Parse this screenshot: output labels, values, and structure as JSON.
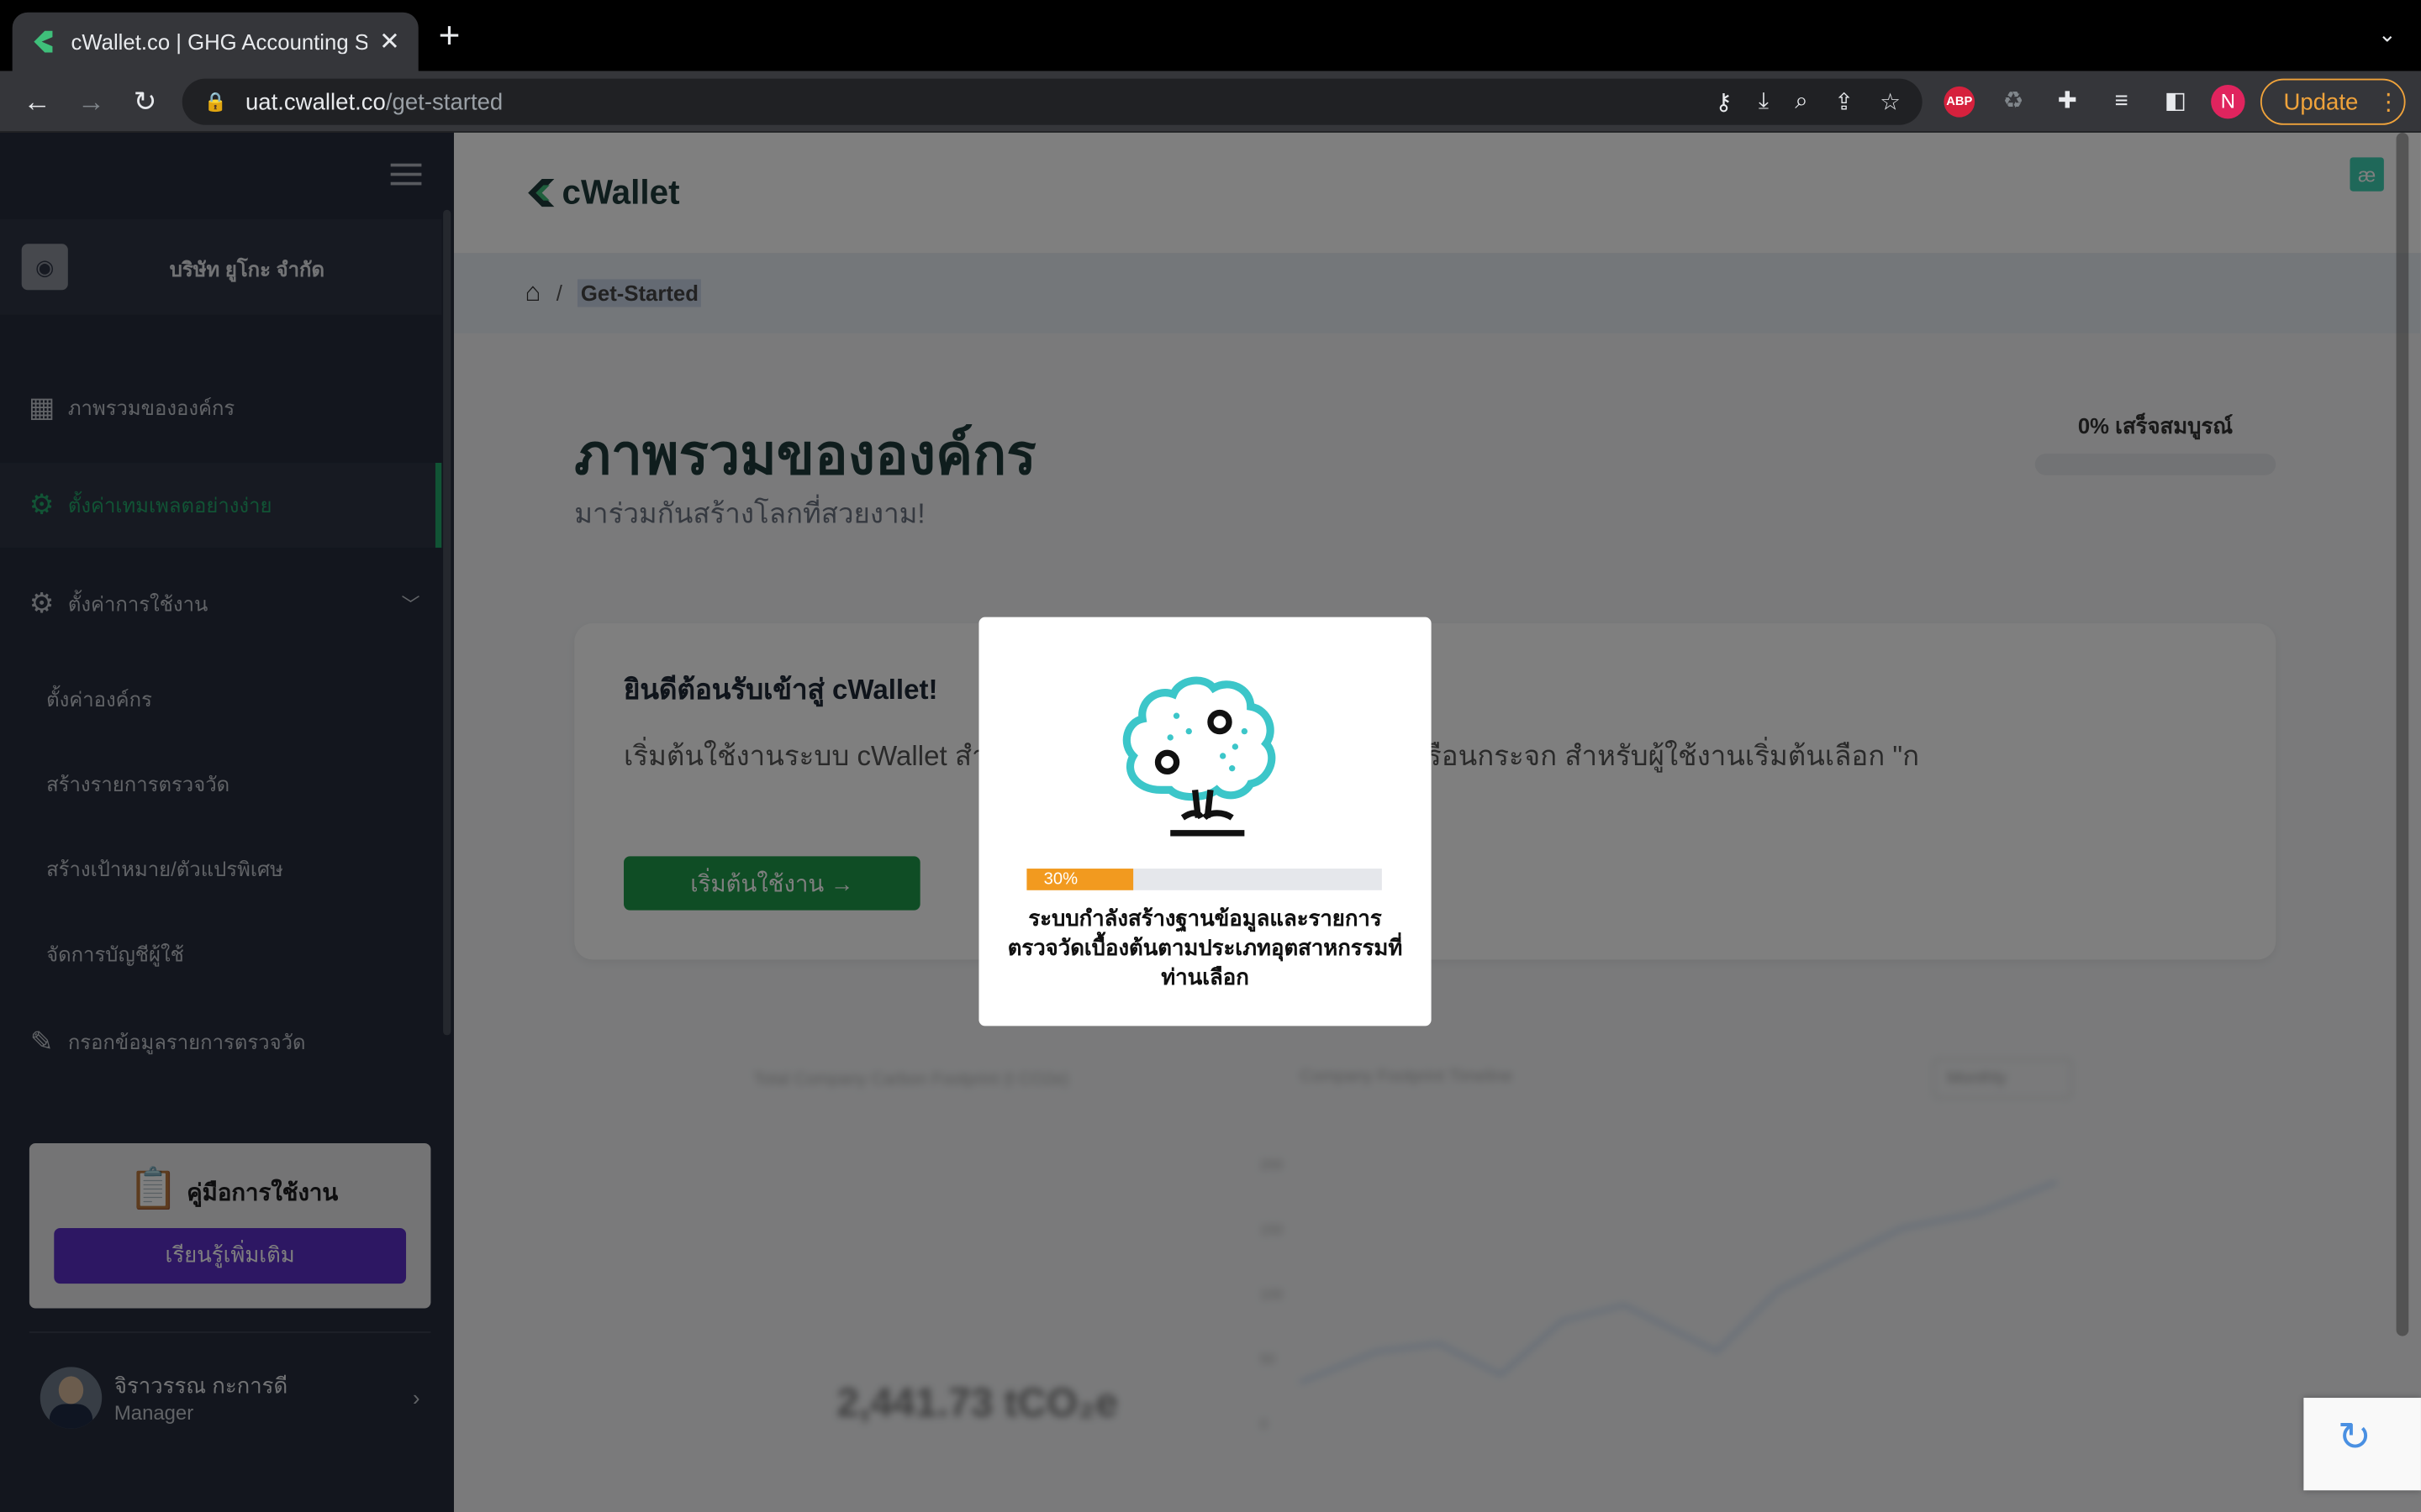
{
  "browser": {
    "tab_title": "cWallet.co | GHG Accounting S",
    "url_host": "uat.cwallet.co",
    "url_path": "/get-started",
    "update_label": "Update",
    "profile_initial": "N",
    "abp_label": "ABP"
  },
  "sidebar": {
    "company_name": "บริษัท ยูโกะ จำกัด",
    "items": [
      {
        "label": "ภาพรวมขององค์กร",
        "icon": "layout-icon"
      },
      {
        "label": "ตั้งค่าเทมเพลตอย่างง่าย",
        "icon": "gear-icon",
        "active": true
      },
      {
        "label": "ตั้งค่าการใช้งาน",
        "icon": "gear-icon",
        "expandable": true
      }
    ],
    "sub_items": [
      "ตั้งค่าองค์กร",
      "สร้างรายการตรวจวัด",
      "สร้างเป้าหมาย/ตัวแปรพิเศษ",
      "จัดการบัญชีผู้ใช้"
    ],
    "data_entry": "กรอกข้อมูลรายการตรวจวัด",
    "manual": {
      "title": "คู่มือการใช้งาน",
      "button": "เรียนรู้เพิ่มเติม"
    },
    "user": {
      "name": "จิราวรรณ กะการดี",
      "role": "Manager"
    }
  },
  "main": {
    "logo_text": "cWallet",
    "breadcrumb": "Get-Started",
    "title": "ภาพรวมขององค์กร",
    "subtitle": "มาร่วมกันสร้างโลกที่สวยงาม!",
    "completion_label": "0% เสร็จสมบูรณ์",
    "completion_value": 0,
    "welcome": {
      "title": "ยินดีต้อนรับเข้าสู่ cWallet!",
      "text": "เริ่มต้นใช้งานระบบ cWallet สำ                                        ค์กรและรูปแบบของการติดตามก๊าซเรือนกระจก สำหรับผู้ใช้งานเริ่มต้นเลือก \"ก",
      "button": "เริ่มต้นใช้งาน →"
    },
    "dashboard": {
      "label_total": "Total Company Carbon Footprint (t CO2e)",
      "label_timeline": "Company Footprint Timeline",
      "period_select": "Monthly",
      "total_value": "2,441.73 tCO₂e",
      "y_ticks": [
        "200",
        "150",
        "100",
        "50",
        "0"
      ]
    }
  },
  "modal": {
    "progress_label": "30%",
    "progress_value": 0.3,
    "message": "ระบบกำลังสร้างฐานข้อมูลและรายการตรวจวัดเบื้องต้นตามประเภทอุตสาหกรรมที่ท่านเลือก"
  },
  "colors": {
    "accent_green": "#22a86b",
    "button_green": "#1f9a4a",
    "purple": "#5b2ec7",
    "progress_orange": "#f29a1f",
    "tree_teal": "#3cc6c9"
  }
}
